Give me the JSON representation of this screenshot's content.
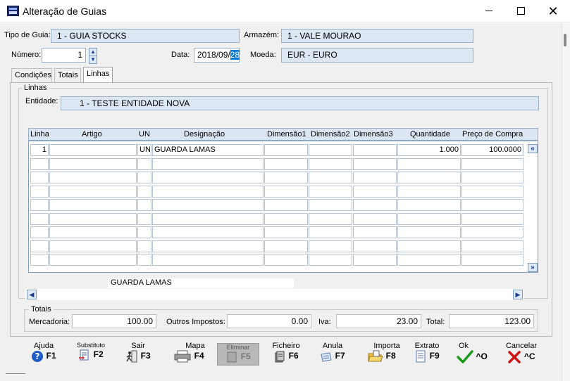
{
  "window": {
    "title": "Alteração de Guias",
    "minimize": "─",
    "maximize": "☐",
    "close": "✕"
  },
  "header": {
    "tipo_guia_label": "Tipo de Guia:",
    "tipo_guia_value": "1 - GUIA STOCKS",
    "armazem_label": "Armazém:",
    "armazem_value": "1 - VALE MOURAO",
    "numero_label": "Número:",
    "numero_value": "1",
    "data_label": "Data:",
    "data_value_prefix": "2018/09/",
    "data_value_selected": "28",
    "moeda_label": "Moeda:",
    "moeda_value": "EUR - EURO"
  },
  "tabs": [
    {
      "label": "Condições",
      "active": false
    },
    {
      "label": "Totais",
      "active": false
    },
    {
      "label": "Linhas",
      "active": true
    }
  ],
  "linhas": {
    "group_label": "Linhas",
    "entidade_label": "Entidade:",
    "entidade_value": "1 - TESTE ENTIDADE NOVA",
    "columns": [
      "Linha",
      "Artigo",
      "UN",
      "Designação",
      "Dimensão1",
      "Dimensão2",
      "Dimensão3",
      "Quantidade",
      "Preço de Compra"
    ],
    "rows": [
      [
        "1",
        "",
        "UN",
        "GUARDA LAMAS",
        "",
        "",
        "",
        "1.000",
        "100.0000"
      ]
    ],
    "empty_rows": 8,
    "selected_description": "GUARDA LAMAS"
  },
  "totais": {
    "group_label": "Totais",
    "mercadoria_label": "Mercadoria:",
    "mercadoria_value": "100.00",
    "outros_label": "Outros Impostos:",
    "outros_value": "0.00",
    "iva_label": "Iva:",
    "iva_value": "23.00",
    "total_label": "Total:",
    "total_value": "123.00"
  },
  "toolbar": [
    {
      "label": "Ajuda",
      "key": "F1",
      "icon": "help-icon"
    },
    {
      "label": "Substituto",
      "key": "F2",
      "icon": "substitute-icon"
    },
    {
      "label": "Sair",
      "key": "F3",
      "icon": "exit-icon"
    },
    {
      "label": "Mapa",
      "key": "F4",
      "icon": "printer-icon"
    },
    {
      "label": "Eliminar",
      "key": "F5",
      "icon": "delete-icon"
    },
    {
      "label": "Ficheiro",
      "key": "F6",
      "icon": "file-icon"
    },
    {
      "label": "Anula",
      "key": "F7",
      "icon": "cancel-doc-icon"
    },
    {
      "label": "Importa",
      "key": "F8",
      "icon": "import-folder-icon"
    },
    {
      "label": "Extrato",
      "key": "F9",
      "icon": "statement-icon"
    },
    {
      "label": "Ok",
      "key": "^O",
      "icon": "checkmark-icon"
    },
    {
      "label": "Cancelar",
      "key": "^C",
      "icon": "x-icon"
    }
  ],
  "colors": {
    "field_bg": "#dde7f3",
    "check_green": "#1a9a1a",
    "cancel_red": "#d01010",
    "help_blue": "#1e5bc6"
  }
}
